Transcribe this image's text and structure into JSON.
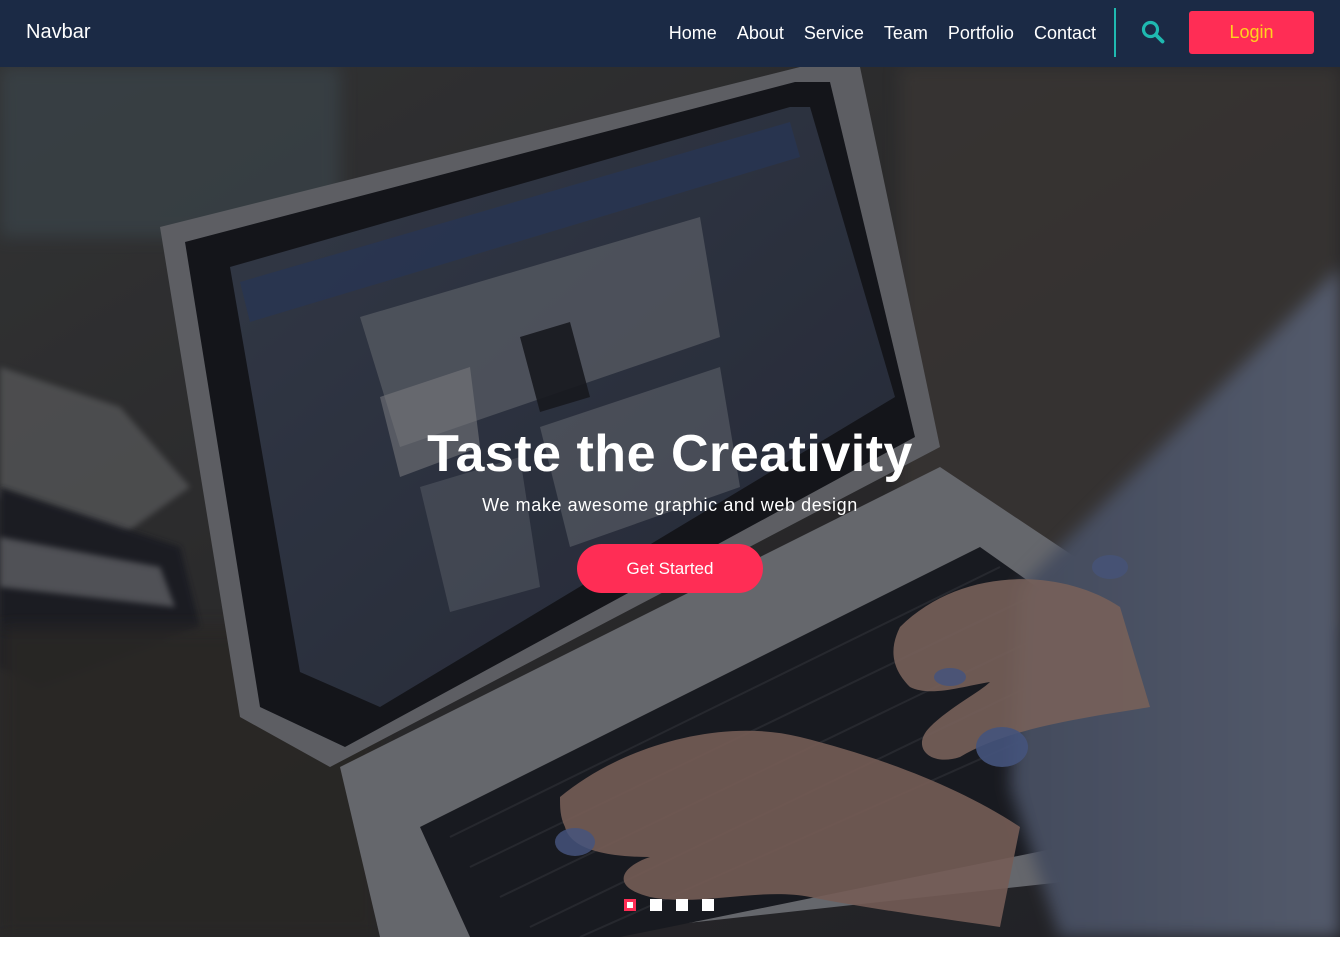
{
  "navbar": {
    "brand": "Navbar",
    "links": [
      {
        "label": "Home"
      },
      {
        "label": "About"
      },
      {
        "label": "Service"
      },
      {
        "label": "Team"
      },
      {
        "label": "Portfolio"
      },
      {
        "label": "Contact"
      }
    ],
    "search_icon": "search-icon",
    "login_label": "Login"
  },
  "hero": {
    "title": "Taste the Creativity",
    "subtitle": "We make awesome graphic and web design",
    "cta_label": "Get Started",
    "background": "photo-of-hands-typing-on-laptop",
    "slides": {
      "count": 4,
      "active_index": 0
    }
  },
  "colors": {
    "navbar_bg": "#1b2a45",
    "accent": "#ff2d55",
    "login_text": "#ffd21f",
    "teal": "#1fb9b0"
  }
}
